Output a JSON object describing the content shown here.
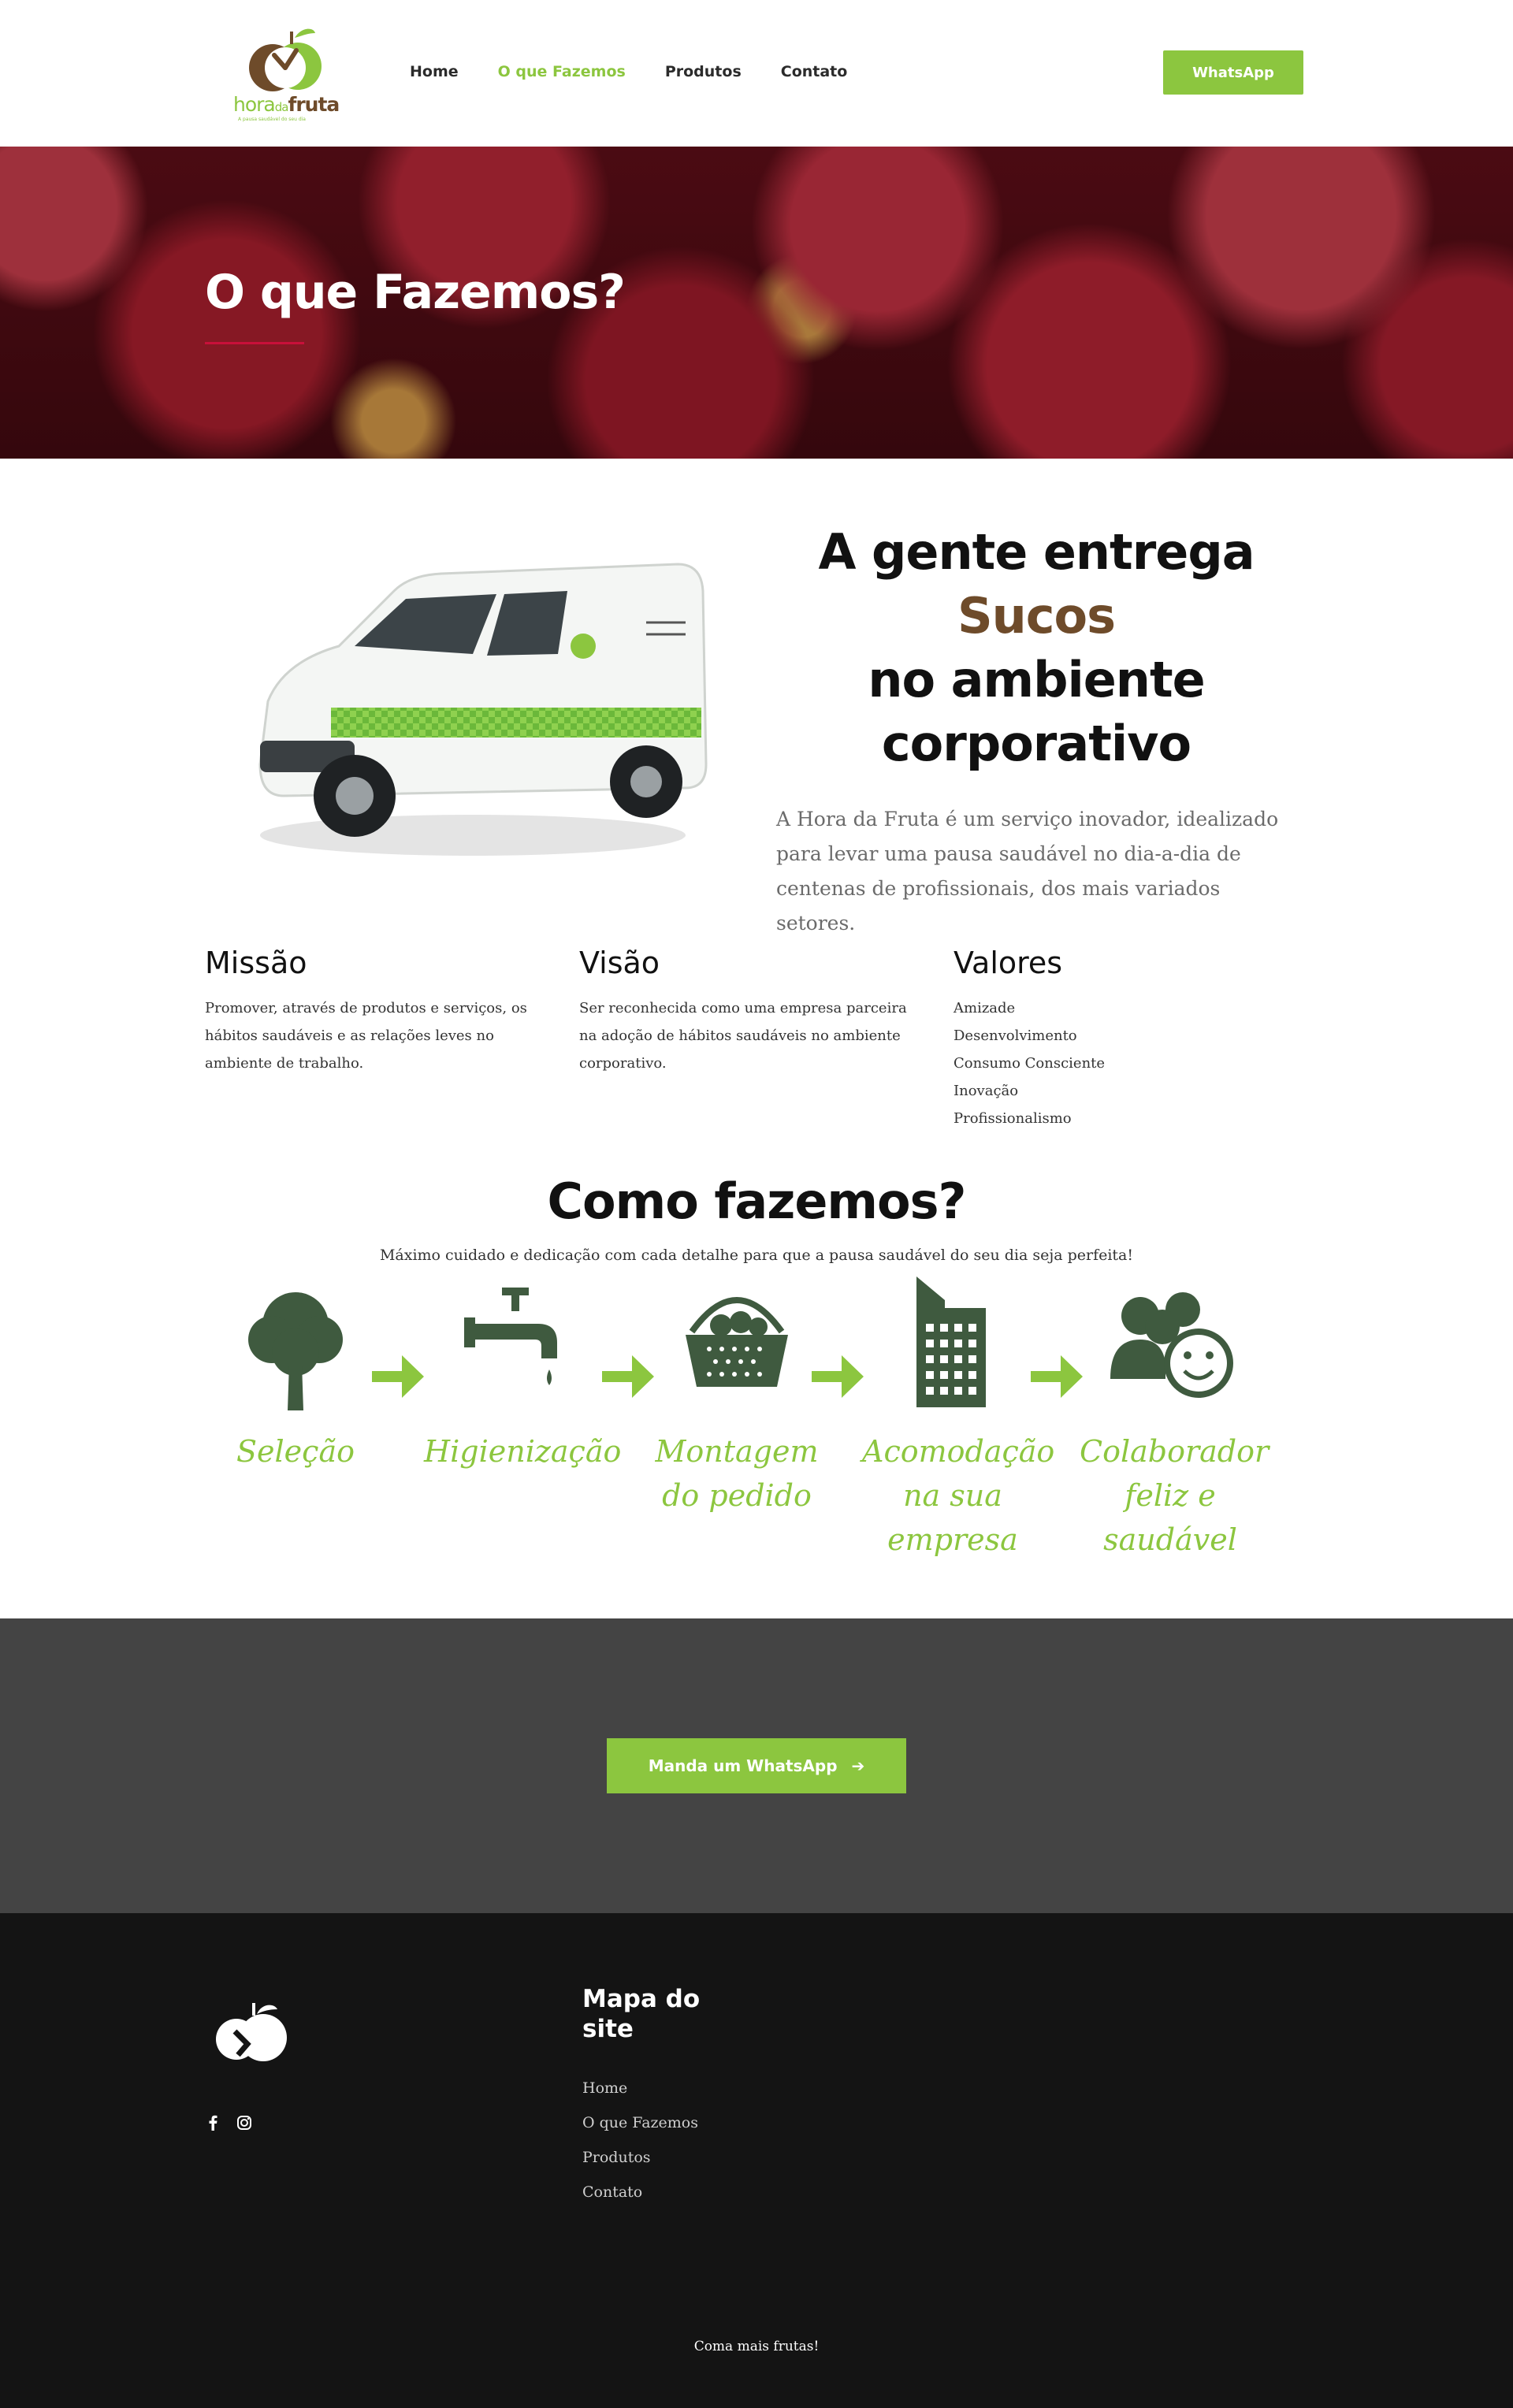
{
  "brand": {
    "name_part1": "hora",
    "name_part2": "da",
    "name_part3": "fruta",
    "tagline": "A pausa saudável do seu dia"
  },
  "nav": {
    "items": [
      {
        "label": "Home"
      },
      {
        "label": "O que Fazemos"
      },
      {
        "label": "Produtos"
      },
      {
        "label": "Contato"
      }
    ],
    "active_color": "#8cc63f"
  },
  "header": {
    "whatsapp_label": "WhatsApp"
  },
  "hero": {
    "title": "O que Fazemos?"
  },
  "intro": {
    "title_line1": "A gente entrega",
    "title_accent": "Sucos",
    "title_line3": "no ambiente corporativo",
    "text": "A Hora da Fruta é um serviço inovador, idealizado para levar uma pausa saudável no dia-a-dia de centenas de profissionais, dos mais variados setores."
  },
  "columns": {
    "missao": {
      "title": "Missão",
      "text": "Promover, através de produtos e serviços, os hábitos saudáveis e as relações leves no ambiente de trabalho."
    },
    "visao": {
      "title": "Visão",
      "text": "Ser reconhecida como uma empresa parceira na adoção de hábitos saudáveis no ambiente corporativo."
    },
    "valores": {
      "title": "Valores",
      "items": [
        "Amizade",
        "Desenvolvimento",
        "Consumo Consciente",
        "Inovação",
        "Profissionalismo"
      ]
    }
  },
  "how": {
    "title": "Como fazemos?",
    "subtitle": "Máximo cuidado e dedicação com cada detalhe para que a pausa saudável do seu dia seja perfeita!",
    "steps": [
      {
        "label": "Seleção",
        "icon": "tree-icon"
      },
      {
        "label": "Higienização",
        "icon": "faucet-icon"
      },
      {
        "label": "Montagem do pedido",
        "icon": "basket-icon"
      },
      {
        "label": "Acomodação na sua empresa",
        "icon": "building-icon"
      },
      {
        "label": "Colaborador feliz e saudável",
        "icon": "happy-people-icon"
      }
    ]
  },
  "cta": {
    "label": "Manda um WhatsApp"
  },
  "footer": {
    "map_title": "Mapa do site",
    "links": [
      {
        "label": "Home"
      },
      {
        "label": "O que Fazemos"
      },
      {
        "label": "Produtos"
      },
      {
        "label": "Contato"
      }
    ],
    "social": [
      "facebook-icon",
      "instagram-icon"
    ],
    "bottom_text": "Coma mais frutas!"
  },
  "colors": {
    "accent_green": "#8cc63f",
    "dark_green_icons": "#3f5a3f",
    "brown": "#6e4b2a",
    "hero_underline": "#c8103a",
    "cta_band": "#444444",
    "footer_bg": "#141414"
  }
}
